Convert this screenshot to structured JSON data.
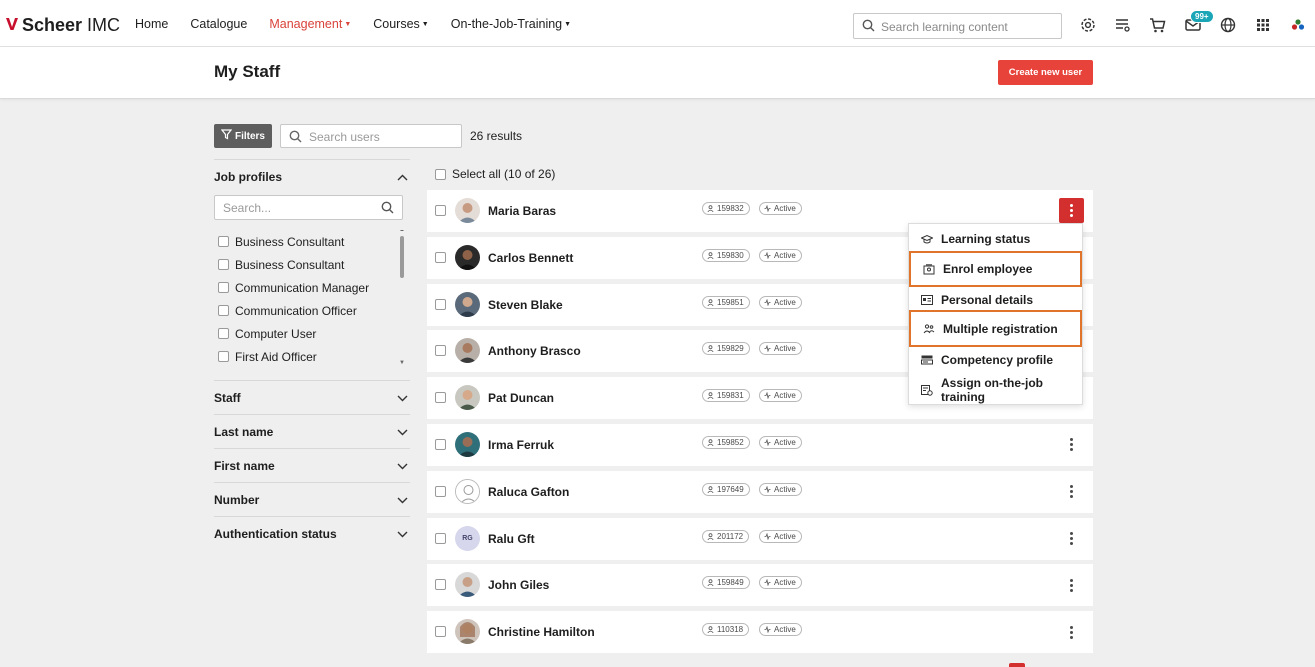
{
  "brand": {
    "name_bold": "Scheer",
    "name_light": " IMC"
  },
  "nav": {
    "home": "Home",
    "catalogue": "Catalogue",
    "management": "Management",
    "courses": "Courses",
    "ojt": "On-the-Job-Training"
  },
  "top_search": {
    "placeholder": "Search learning content"
  },
  "notifications": {
    "badge": "99+"
  },
  "page": {
    "title": "My Staff",
    "create_button": "Create new user"
  },
  "toolbar": {
    "filters_label": "Filters",
    "search_placeholder": "Search users",
    "results": "26 results"
  },
  "filters": {
    "job_profiles": {
      "title": "Job profiles",
      "search_placeholder": "Search...",
      "items": [
        "Business Consultant",
        "Business Consultant",
        "Communication Manager",
        "Communication Officer",
        "Computer User",
        "First Aid Officer"
      ]
    },
    "staff": "Staff",
    "last_name": "Last name",
    "first_name": "First name",
    "number": "Number",
    "auth_status": "Authentication status"
  },
  "select_all": "Select all (10 of 26)",
  "users": [
    {
      "name": "Maria Baras",
      "id": "159832",
      "status": "Active"
    },
    {
      "name": "Carlos Bennett",
      "id": "159830",
      "status": "Active"
    },
    {
      "name": "Steven Blake",
      "id": "159851",
      "status": "Active"
    },
    {
      "name": "Anthony Brasco",
      "id": "159829",
      "status": "Active"
    },
    {
      "name": "Pat Duncan",
      "id": "159831",
      "status": "Active"
    },
    {
      "name": "Irma Ferruk",
      "id": "159852",
      "status": "Active"
    },
    {
      "name": "Raluca Gafton",
      "id": "197649",
      "status": "Active"
    },
    {
      "name": "Ralu Gft",
      "id": "201172",
      "status": "Active",
      "initials": "RG"
    },
    {
      "name": "John Giles",
      "id": "159849",
      "status": "Active"
    },
    {
      "name": "Christine Hamilton",
      "id": "110318",
      "status": "Active"
    }
  ],
  "menu": {
    "items": [
      "Learning status",
      "Enrol employee",
      "Personal details",
      "Multiple registration",
      "Competency profile",
      "Assign on-the-job training"
    ]
  },
  "colors": {
    "accent": "#e8433b",
    "highlight_border": "#e0742a",
    "badge": "#1aa6b7"
  }
}
